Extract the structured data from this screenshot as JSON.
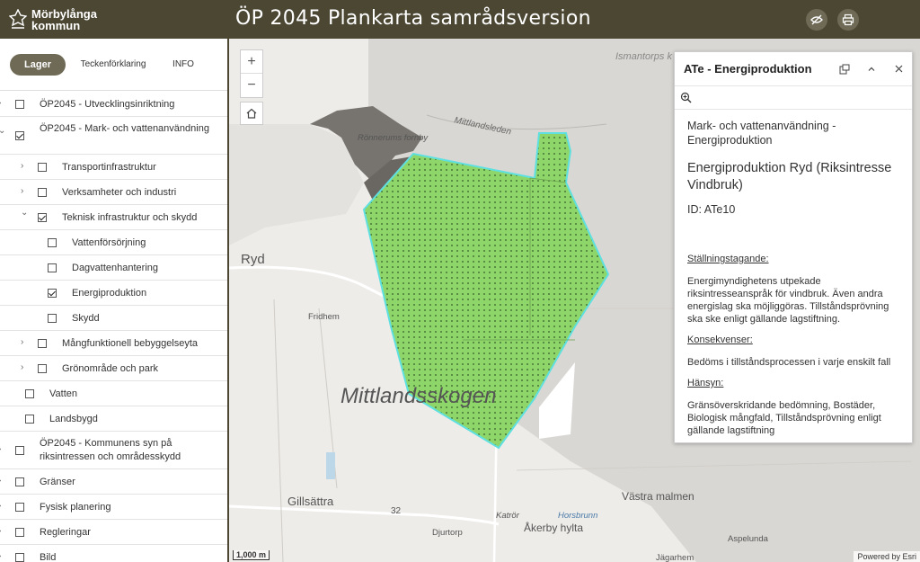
{
  "header": {
    "logo_line1": "Mörbylånga",
    "logo_line2": "kommun",
    "title": "ÖP 2045  Plankarta samrådsversion",
    "buttons": [
      {
        "name": "toggle-icon"
      },
      {
        "name": "print-icon"
      }
    ]
  },
  "sidebar": {
    "tabs": [
      {
        "label": "Lager",
        "active": true
      },
      {
        "label": "Teckenförklaring",
        "active": false
      },
      {
        "label": "INFO",
        "active": false
      }
    ],
    "items": [
      {
        "label": "ÖP2045 - Utvecklingsinriktning",
        "level": 0,
        "chevron": "right",
        "checked": false
      },
      {
        "label": "ÖP2045 - Mark- och vattenanvändning",
        "level": 0,
        "chevron": "down",
        "checked": true
      },
      {
        "label": "Transportinfrastruktur",
        "level": 1,
        "chevron": "right",
        "checked": false
      },
      {
        "label": "Verksamheter och industri",
        "level": 1,
        "chevron": "right",
        "checked": false
      },
      {
        "label": "Teknisk infrastruktur och skydd",
        "level": 1,
        "chevron": "down",
        "checked": true
      },
      {
        "label": "Vattenförsörjning",
        "level": 2,
        "chevron": "",
        "checked": false
      },
      {
        "label": "Dagvattenhantering",
        "level": 2,
        "chevron": "",
        "checked": false
      },
      {
        "label": "Energiproduktion",
        "level": 2,
        "chevron": "",
        "checked": true
      },
      {
        "label": "Skydd",
        "level": 2,
        "chevron": "",
        "checked": false
      },
      {
        "label": "Mångfunktionell bebyggelseyta",
        "level": 1,
        "chevron": "right",
        "checked": false
      },
      {
        "label": "Grönområde och park",
        "level": 1,
        "chevron": "right",
        "checked": false
      },
      {
        "label": "Vatten",
        "level": 1,
        "chevron": "",
        "checked": false
      },
      {
        "label": "Landsbygd",
        "level": 1,
        "chevron": "",
        "checked": false
      },
      {
        "label": "ÖP2045 - Kommunens syn på riksintressen och områdesskydd",
        "level": 0,
        "chevron": "right",
        "checked": false
      },
      {
        "label": "Gränser",
        "level": 0,
        "chevron": "right",
        "checked": false
      },
      {
        "label": "Fysisk planering",
        "level": 0,
        "chevron": "right",
        "checked": false
      },
      {
        "label": "Regleringar",
        "level": 0,
        "chevron": "right",
        "checked": false
      },
      {
        "label": "Bild",
        "level": 0,
        "chevron": "right",
        "checked": false
      }
    ]
  },
  "map": {
    "labels": {
      "ismantorps": "Ismantorps k",
      "mittlandsleden": "Mittlandsleden",
      "ronnerums": "Rönnerums fornby",
      "ryd": "Ryd",
      "fridhem": "Fridhem",
      "mittlandsskogen": "Mittlandsskogen",
      "gillsattra": "Gillsättra",
      "road_32": "32",
      "katror": "Katrör",
      "djurtorp": "Djurtorp",
      "akerby": "Åkerby hylta",
      "vastra_malmen": "Västra malmen",
      "horsbrunn": "Horsbrunn",
      "aspelunda": "Aspelunda",
      "jagarhem": "Jägarhem"
    },
    "zoom_in": "+",
    "zoom_out": "−",
    "scale_label": "1,000 m",
    "attribution": "Powered by Esri",
    "polygon_fill": "#8fd66a",
    "polygon_outline": "#5fe0e0"
  },
  "popup": {
    "title": "ATe - Energiproduktion",
    "subtitle": "Mark- och vattenanvändning - Energiproduktion",
    "name": "Energiproduktion Ryd (Riksintresse Vindbruk)",
    "id_text": "ID: ATe10",
    "sections": [
      {
        "heading": "Ställningstagande:",
        "text": "Energimyndighetens utpekade riksintresseanspråk för vindbruk. Även andra energislag ska möjliggöras. Tillståndsprövning ska ske enligt gällande lagstiftning."
      },
      {
        "heading": "Konsekvenser:",
        "text": "Bedöms i tillståndsprocessen i varje enskilt fall"
      },
      {
        "heading": "Hänsyn:",
        "text": "Gränsöverskridande bedömning, Bostäder, Biologisk mångfald, Tillståndsprövning enligt gällande lagstiftning"
      }
    ]
  }
}
